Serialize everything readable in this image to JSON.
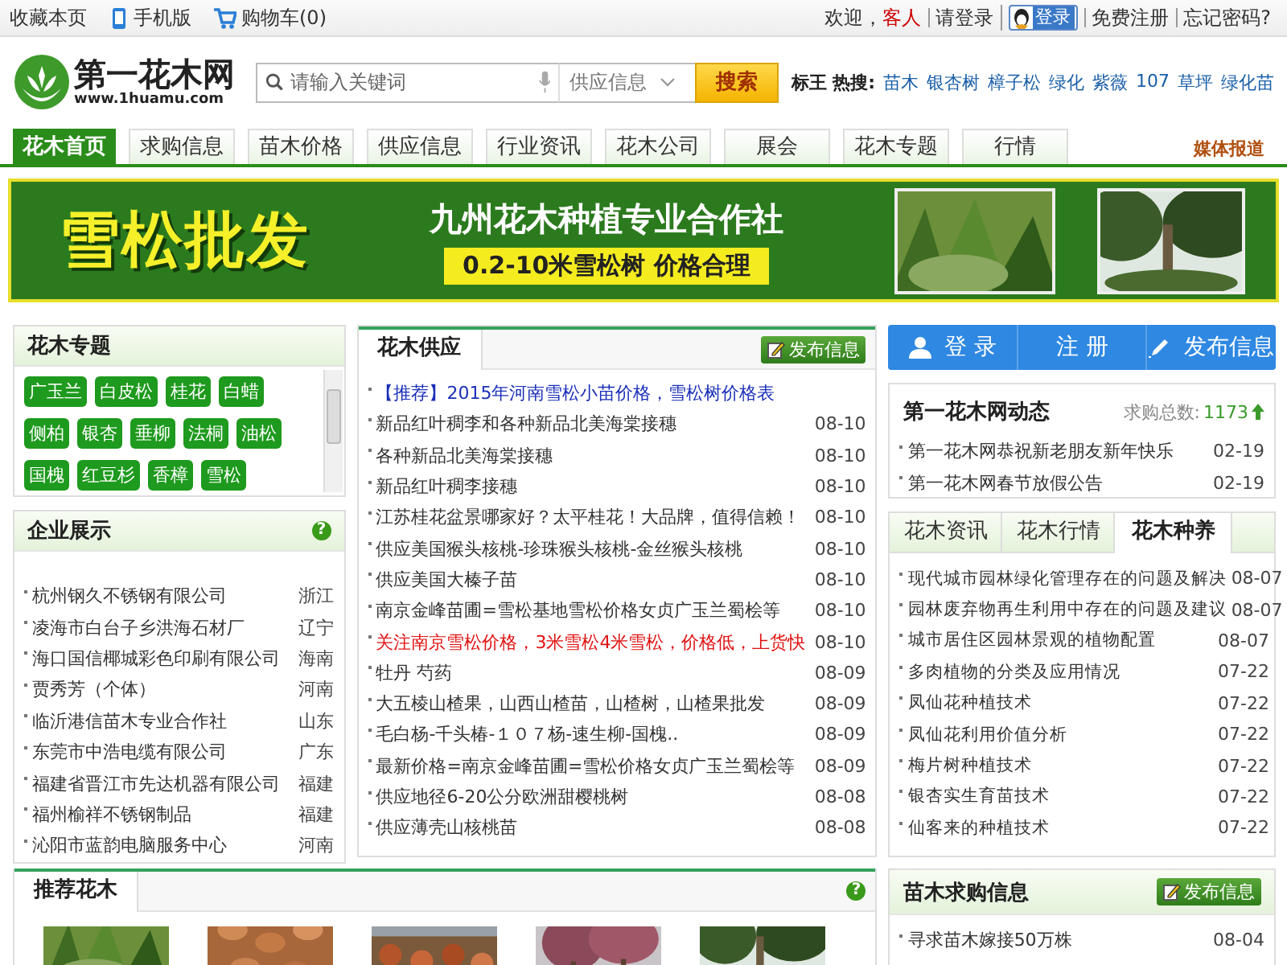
{
  "topbar": {
    "left": [
      {
        "kind": "text",
        "label": "收藏本页"
      },
      {
        "kind": "phone",
        "label": "手机版"
      },
      {
        "kind": "cart",
        "label": "购物车(0)"
      }
    ],
    "welcome": "欢迎，",
    "guest": "客人",
    "login": "请登录",
    "qq_login": "登录",
    "links": [
      "免费注册",
      "忘记密码?"
    ]
  },
  "header": {
    "logo_title": "第一花木网",
    "logo_url": "www.1huamu.com",
    "search": {
      "placeholder": "请输入关键词",
      "category": "供应信息",
      "button": "搜索"
    },
    "hot_label": "标王 热搜:",
    "hot": [
      "苗木",
      "银杏树",
      "樟子松",
      "绿化",
      "紫薇",
      "107",
      "草坪",
      "绿化苗"
    ]
  },
  "nav": {
    "tabs": [
      {
        "label": "花木首页",
        "selected": true
      },
      {
        "label": "求购信息",
        "selected": false
      },
      {
        "label": "苗木价格",
        "selected": false
      },
      {
        "label": "供应信息",
        "selected": false
      },
      {
        "label": "行业资讯",
        "selected": false
      },
      {
        "label": "花木公司",
        "selected": false
      },
      {
        "label": "展会",
        "selected": false
      },
      {
        "label": "花木专题",
        "selected": false
      },
      {
        "label": "行情",
        "selected": false
      }
    ],
    "media": "媒体报道"
  },
  "banner": {
    "title": "雪松批发",
    "org": "九州花木种植专业合作社",
    "slogan": "0.2-10米雪松树  价格合理"
  },
  "topics": {
    "title": "花木专题",
    "tags": [
      "广玉兰",
      "白皮松",
      "桂花",
      "白蜡",
      "侧柏",
      "银杏",
      "垂柳",
      "法桐",
      "油松",
      "国槐",
      "红豆杉",
      "香樟",
      "雪松"
    ]
  },
  "companies": {
    "title": "企业展示",
    "help": "?",
    "rows": [
      {
        "name": "杭州钢久不锈钢有限公司",
        "region": "浙江"
      },
      {
        "name": "凌海市白台子乡洪海石材厂",
        "region": "辽宁"
      },
      {
        "name": "海口国信椰城彩色印刷有限公司",
        "region": "海南"
      },
      {
        "name": "贾秀芳（个体）",
        "region": "河南"
      },
      {
        "name": "临沂港信苗木专业合作社",
        "region": "山东"
      },
      {
        "name": "东莞市中浩电缆有限公司",
        "region": "广东"
      },
      {
        "name": "福建省晋江市先达机器有限公司",
        "region": "福建"
      },
      {
        "name": "福州榆祥不锈钢制品",
        "region": "福建"
      },
      {
        "name": "沁阳市蓝韵电脑服务中心",
        "region": "河南"
      }
    ]
  },
  "supply": {
    "title": "花木供应",
    "publish": "发布信息",
    "rows": [
      {
        "kind": "recommend",
        "text": "【推荐】2015年河南雪松小苗价格，雪松树价格表"
      },
      {
        "kind": "normal",
        "text": "新品红叶稠李和各种新品北美海棠接穗",
        "date": "08-10"
      },
      {
        "kind": "normal",
        "text": "各种新品北美海棠接穗",
        "date": "08-10"
      },
      {
        "kind": "normal",
        "text": "新品红叶稠李接穗",
        "date": "08-10"
      },
      {
        "kind": "normal",
        "text": "江苏桂花盆景哪家好？太平桂花！大品牌，值得信赖！",
        "date": "08-10"
      },
      {
        "kind": "normal",
        "text": "供应美国猴头核桃-珍珠猴头核桃-金丝猴头核桃",
        "date": "08-10"
      },
      {
        "kind": "normal",
        "text": "供应美国大榛子苗",
        "date": "08-10"
      },
      {
        "kind": "normal",
        "text": "南京金峰苗圃=雪松基地雪松价格女贞广玉兰蜀桧等",
        "date": "08-10"
      },
      {
        "kind": "highlight",
        "text": "关注南京雪松价格，3米雪松4米雪松，价格低，上货快",
        "date": "08-10"
      },
      {
        "kind": "normal",
        "text": "牡丹 芍药",
        "date": "08-09"
      },
      {
        "kind": "normal",
        "text": "大五棱山楂果，山西山楂苗，山楂树，山楂果批发",
        "date": "08-09"
      },
      {
        "kind": "normal",
        "text": "毛白杨-千头椿-１０７杨-速生柳-国槐..",
        "date": "08-09"
      },
      {
        "kind": "normal",
        "text": "最新价格=南京金峰苗圃=雪松价格女贞广玉兰蜀桧等",
        "date": "08-09"
      },
      {
        "kind": "normal",
        "text": "供应地径6-20公分欧洲甜樱桃树",
        "date": "08-08"
      },
      {
        "kind": "normal",
        "text": "供应薄壳山核桃苗",
        "date": "08-08"
      }
    ]
  },
  "account": [
    {
      "kind": "user",
      "label": "登 录"
    },
    {
      "kind": "none",
      "label": "注 册"
    },
    {
      "kind": "pencil",
      "label": "发布信息"
    }
  ],
  "news": {
    "title": "第一花木网动态",
    "count_label": "求购总数:",
    "count": "1173",
    "rows": [
      {
        "text": "第一花木网恭祝新老朋友新年快乐",
        "date": "02-19"
      },
      {
        "text": "第一花木网春节放假公告",
        "date": "02-19"
      }
    ]
  },
  "articles": {
    "tabs": [
      {
        "label": "花木资讯",
        "selected": false
      },
      {
        "label": "花木行情",
        "selected": false
      },
      {
        "label": "花木种养",
        "selected": true
      }
    ],
    "rows": [
      {
        "text": "现代城市园林绿化管理存在的问题及解决",
        "date": "08-07"
      },
      {
        "text": "园林废弃物再生利用中存在的问题及建议",
        "date": "08-07"
      },
      {
        "text": "城市居住区园林景观的植物配置",
        "date": "08-07"
      },
      {
        "text": "多肉植物的分类及应用情况",
        "date": "07-22"
      },
      {
        "text": "凤仙花种植技术",
        "date": "07-22"
      },
      {
        "text": "凤仙花利用价值分析",
        "date": "07-22"
      },
      {
        "text": "梅片树种植技术",
        "date": "07-22"
      },
      {
        "text": "银杏实生育苗技术",
        "date": "07-22"
      },
      {
        "text": "仙客来的种植技术",
        "date": "07-22"
      }
    ]
  },
  "recommended": {
    "title": "推荐花木",
    "help": "?"
  },
  "purchase": {
    "title": "苗木求购信息",
    "publish": "发布信息",
    "rows": [
      {
        "text": "寻求苗木嫁接50万株",
        "date": "08-04"
      }
    ]
  }
}
